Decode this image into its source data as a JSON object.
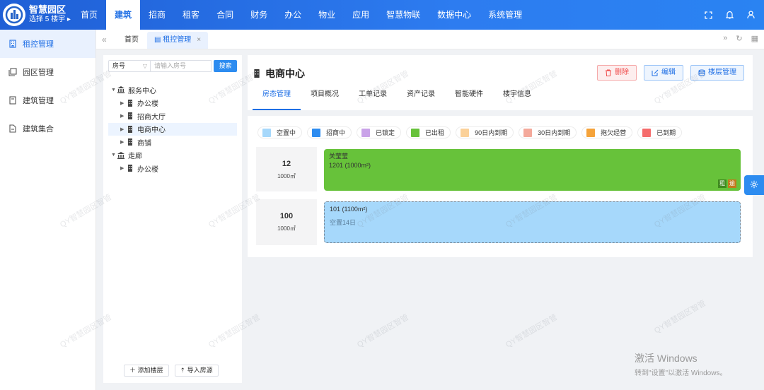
{
  "brand": {
    "title": "智慧园区",
    "subtitle": "选择 5 楼宇 ▸"
  },
  "nav": [
    "首页",
    "建筑",
    "招商",
    "租客",
    "合同",
    "财务",
    "办公",
    "物业",
    "应用",
    "智慧物联",
    "数据中心",
    "系统管理"
  ],
  "nav_active": "建筑",
  "sidebar": [
    {
      "label": "租控管理",
      "icon": "building-icon",
      "active": true
    },
    {
      "label": "园区管理",
      "icon": "copy-icon",
      "active": false
    },
    {
      "label": "建筑管理",
      "icon": "book-icon",
      "active": false
    },
    {
      "label": "建筑集合",
      "icon": "document-icon",
      "active": false
    }
  ],
  "tabs": {
    "home": "首页",
    "current": "租控管理"
  },
  "search": {
    "select_value": "房号",
    "placeholder": "请输入房号",
    "button": "搜索"
  },
  "tree": [
    {
      "label": "服务中心",
      "level": 0,
      "expanded": true,
      "icon": "bank-icon"
    },
    {
      "label": "办公楼",
      "level": 1,
      "icon": "building-icon"
    },
    {
      "label": "招商大厅",
      "level": 1,
      "icon": "building-icon"
    },
    {
      "label": "电商中心",
      "level": 1,
      "icon": "building-icon",
      "selected": true
    },
    {
      "label": "商铺",
      "level": 1,
      "icon": "building-icon"
    },
    {
      "label": "走廊",
      "level": 0,
      "expanded": true,
      "icon": "bank-icon"
    },
    {
      "label": "办公楼",
      "level": 1,
      "icon": "building-icon"
    }
  ],
  "tree_actions": {
    "add_floor": "添加楼层",
    "import_rooms": "导入房源"
  },
  "main": {
    "title": "电商中心",
    "buttons": {
      "delete": "删除",
      "edit": "编辑",
      "floors": "楼层管理"
    },
    "subtabs": [
      "房态管理",
      "项目概况",
      "工单记录",
      "资产记录",
      "智能硬件",
      "楼宇信息"
    ],
    "subtab_active": "房态管理"
  },
  "legend": [
    {
      "label": "空置中",
      "color": "#a6d8fb"
    },
    {
      "label": "招商中",
      "color": "#2d8cf0"
    },
    {
      "label": "已锁定",
      "color": "#c9a2e8"
    },
    {
      "label": "已出租",
      "color": "#67c23a"
    },
    {
      "label": "90日内到期",
      "color": "#fbd199"
    },
    {
      "label": "30日内到期",
      "color": "#f4a99b"
    },
    {
      "label": "拖欠经营",
      "color": "#f5a33a"
    },
    {
      "label": "已到期",
      "color": "#f56c6c"
    }
  ],
  "floors": [
    {
      "number": "12",
      "area": "1000㎡",
      "room": {
        "tenant": "关莹莹",
        "name": "1201 (1000m²)",
        "status": "rented",
        "tags": [
          "租",
          "逾"
        ]
      }
    },
    {
      "number": "100",
      "area": "1000㎡",
      "room": {
        "name": "101 (1100m²)",
        "status": "vacant",
        "note": "空置14日"
      }
    }
  ],
  "watermark": "QY智慧园区智管",
  "windows_activation": {
    "line1": "激活 Windows",
    "line2": "转到\"设置\"以激活 Windows。"
  }
}
